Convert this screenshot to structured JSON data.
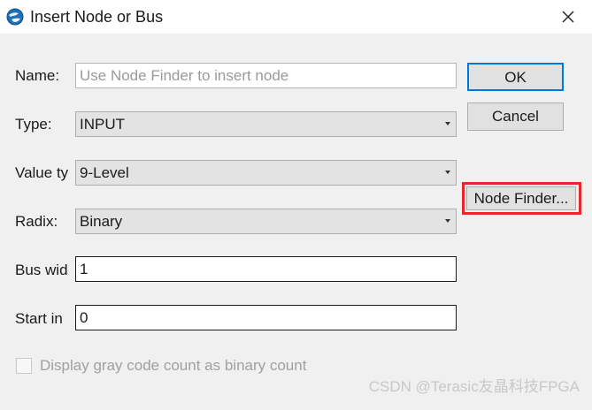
{
  "window": {
    "title": "Insert Node or Bus",
    "icon": "quartus-globe-icon",
    "close_glyph": "✕"
  },
  "form": {
    "name": {
      "label": "Name:",
      "value": "",
      "placeholder": "Use Node Finder to insert node"
    },
    "type": {
      "label": "Type:",
      "selected": "INPUT"
    },
    "value_type": {
      "label": "Value ty",
      "selected": "9-Level"
    },
    "radix": {
      "label": "Radix:",
      "selected": "Binary"
    },
    "bus_width": {
      "label": "Bus wid",
      "value": "1"
    },
    "start_index": {
      "label": "Start in",
      "value": "0"
    },
    "gray_code": {
      "label": "Display gray code count as binary count",
      "checked": false,
      "enabled": false
    }
  },
  "buttons": {
    "ok": "OK",
    "cancel": "Cancel",
    "node_finder": "Node Finder..."
  },
  "annotation": {
    "highlight_color": "#e8262c"
  },
  "watermark": "CSDN @Terasic友晶科技FPGA"
}
